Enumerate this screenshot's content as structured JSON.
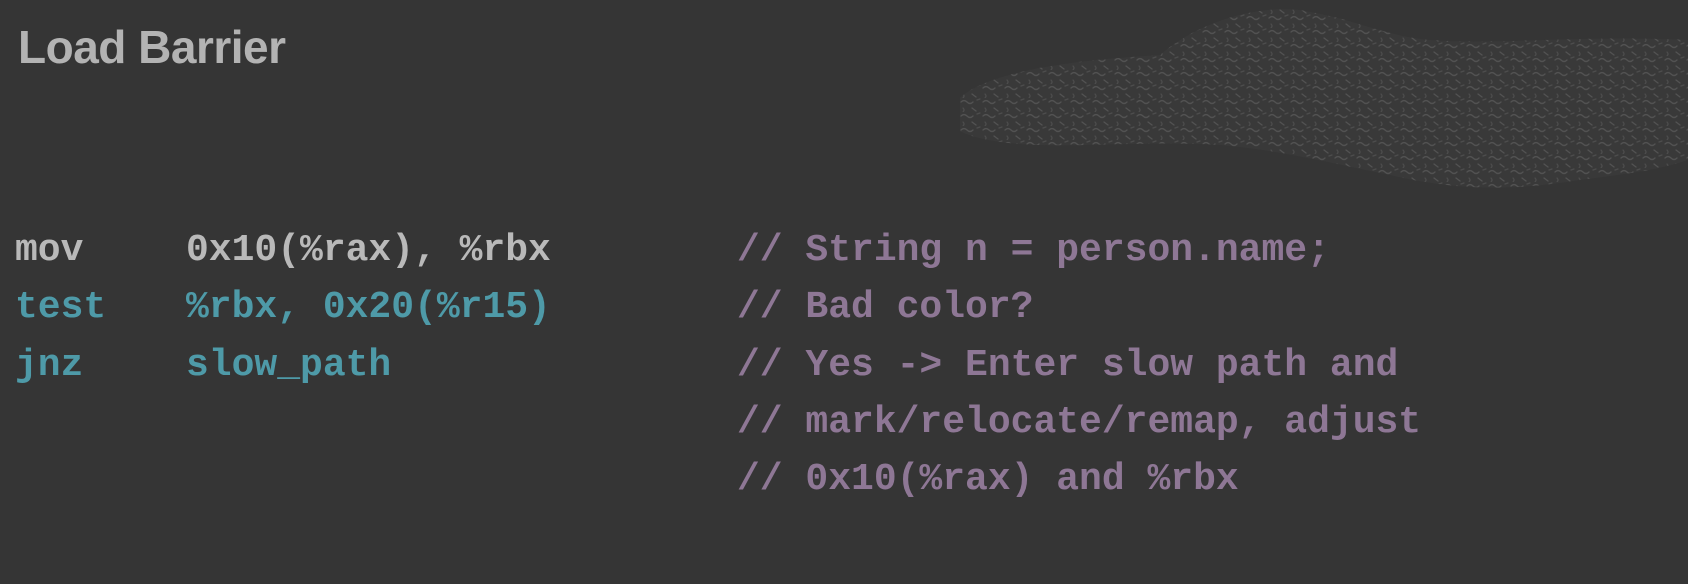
{
  "slide": {
    "title": "Load Barrier"
  },
  "code": {
    "instructions": [
      {
        "mnemonic": "mov",
        "operands": "0x10(%rax), %rbx"
      },
      {
        "mnemonic": "test",
        "operands": "%rbx, 0x20(%r15)"
      },
      {
        "mnemonic": "jnz",
        "operands": "slow_path"
      }
    ],
    "comments": [
      "// String n = person.name;",
      "// Bad color?",
      "// Yes -> Enter slow path and",
      "// mark/relocate/remap, adjust",
      "// 0x10(%rax) and %rbx"
    ]
  },
  "colors": {
    "background": "#353535",
    "title": "#b3b3b3",
    "normal_code": "#b9b9b9",
    "highlight_code": "#4e9aa8",
    "comment": "#8e7795"
  },
  "decoration": {
    "texture_icon": "worm-texture-icon"
  }
}
